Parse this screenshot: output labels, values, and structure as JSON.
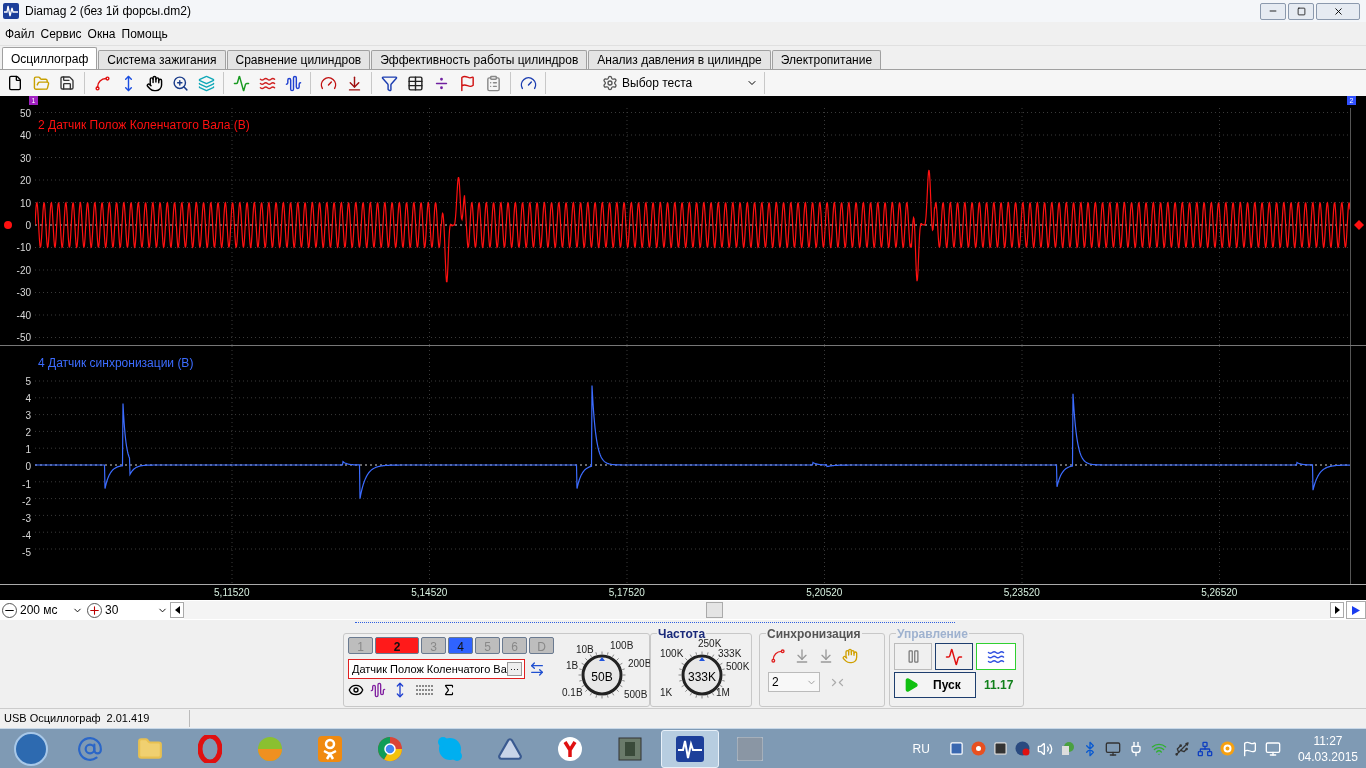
{
  "window": {
    "title": "Diamag 2 (без 1й форсы.dm2)"
  },
  "menu": [
    "Файл",
    "Сервис",
    "Окна",
    "Помощь"
  ],
  "tabs": [
    {
      "label": "Осциллограф",
      "selected": true
    },
    {
      "label": "Система зажигания",
      "selected": false
    },
    {
      "label": "Сравнение цилиндров",
      "selected": false
    },
    {
      "label": "Эффективность работы цилиндров",
      "selected": false
    },
    {
      "label": "Анализ давления в цилиндре",
      "selected": false
    },
    {
      "label": "Электропитание",
      "selected": false
    }
  ],
  "toolbar": {
    "test_select": "Выбор теста"
  },
  "scope": {
    "markers": [
      "1",
      "2"
    ],
    "panes": [
      {
        "title": "2 Датчик Полож Коленчатого Вала (В)",
        "color": "#ff1010",
        "y_labels": [
          "50",
          "40",
          "30",
          "20",
          "10",
          "0",
          "-10",
          "-20",
          "-30",
          "-40",
          "-50"
        ]
      },
      {
        "title": "4 Датчик синхронизации (В)",
        "color": "#3c6cff",
        "y_labels": [
          "5",
          "4",
          "3",
          "2",
          "1",
          "0",
          "-1",
          "-2",
          "-3",
          "-4",
          "-5"
        ]
      }
    ],
    "x_labels": [
      "5,11520",
      "5,14520",
      "5,17520",
      "5,20520",
      "5,23520",
      "5,26520"
    ]
  },
  "timebase": {
    "zoom_out": "200 мс",
    "zoom_in": "30"
  },
  "channels": [
    {
      "label": "1",
      "on": false,
      "selected": false,
      "color": "#bdbdbd"
    },
    {
      "label": "2",
      "on": true,
      "selected": true,
      "color": "#ff1a1a"
    },
    {
      "label": "3",
      "on": false,
      "selected": false,
      "color": "#bdbdbd"
    },
    {
      "label": "4",
      "on": true,
      "selected": false,
      "color": "#2f63ff"
    },
    {
      "label": "5",
      "on": false,
      "selected": false,
      "color": "#bdbdbd"
    },
    {
      "label": "6",
      "on": false,
      "selected": false,
      "color": "#bdbdbd"
    },
    {
      "label": "D",
      "on": false,
      "selected": false,
      "color": "#bdbdbd"
    }
  ],
  "channel_name": "Датчик Полож Коленчатого Ва",
  "browse_button": "···",
  "voltage_knob": {
    "labels": [
      "10В",
      "100В",
      "1В",
      "200В",
      "0.1В",
      "500В"
    ],
    "value": "50В"
  },
  "frequency": {
    "title": "Частота",
    "labels": [
      "250K",
      "100K",
      "333K",
      "500K",
      "1K",
      "1M"
    ],
    "value": "333K"
  },
  "sync": {
    "title": "Синхронизация",
    "channel": "2"
  },
  "control": {
    "title": "Управление",
    "start": "Пуск",
    "reading": "11.17"
  },
  "status_bar": [
    "USB Осциллограф",
    "2.01.419"
  ],
  "taskbar": {
    "language": "RU",
    "time": "11:27",
    "date": "04.03.2015"
  }
}
